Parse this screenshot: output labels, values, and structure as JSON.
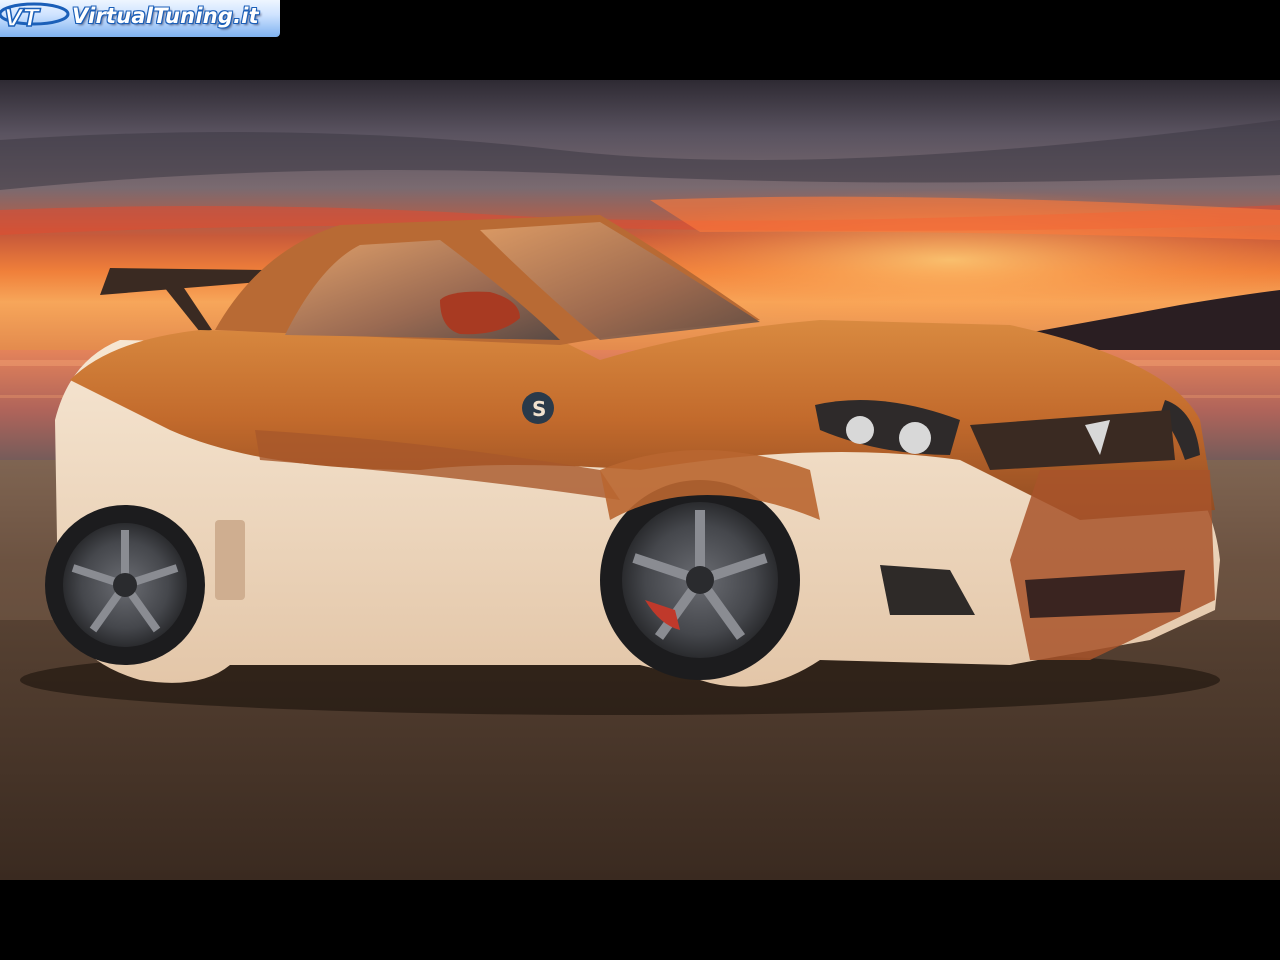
{
  "watermark": {
    "text": "VirtualTuning.it",
    "logo": "VT"
  },
  "decal": {
    "brand": "sparco"
  },
  "colors": {
    "sky_top": "#4a4552",
    "sunset_red": "#e8402a",
    "sunset_orange": "#f59a3a",
    "car_body_orange": "#c8702e",
    "car_body_cream": "#f1dcc4",
    "ground": "#4d3a2c",
    "wheel": "#3f4146",
    "watermark_blue": "#1b5fb8"
  }
}
